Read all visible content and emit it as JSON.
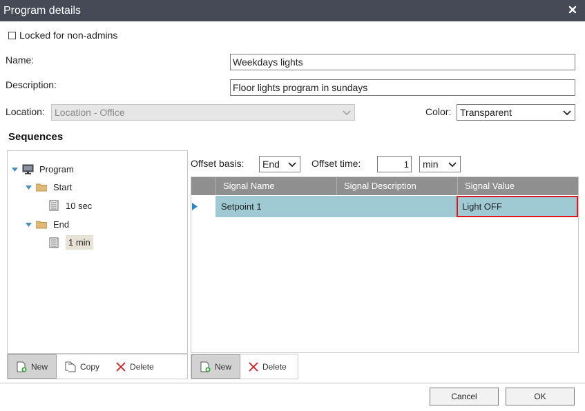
{
  "dialog": {
    "title": "Program details"
  },
  "locked": {
    "label": "Locked for non-admins",
    "checked": false
  },
  "fields": {
    "name_label": "Name:",
    "name_value": "Weekdays lights",
    "description_label": "Description:",
    "description_value": "Floor lights program in sundays",
    "location_label": "Location:",
    "location_value": "Location - Office",
    "color_label": "Color:",
    "color_value": "Transparent"
  },
  "sequences": {
    "title": "Sequences",
    "tree": {
      "root": "Program",
      "start": "Start",
      "start_child": "10 sec",
      "end": "End",
      "end_child": "1 min"
    },
    "toolbar": {
      "new": "New",
      "copy": "Copy",
      "delete": "Delete"
    }
  },
  "offset": {
    "basis_label": "Offset basis:",
    "basis_value": "End",
    "time_label": "Offset time:",
    "time_value": "1",
    "unit_value": "min"
  },
  "signals": {
    "columns": [
      "Signal Name",
      "Signal Description",
      "Signal Value"
    ],
    "rows": [
      {
        "name": "Setpoint 1",
        "description": "",
        "value": "Light OFF"
      }
    ],
    "toolbar": {
      "new": "New",
      "delete": "Delete"
    }
  },
  "buttons": {
    "cancel": "Cancel",
    "ok": "OK"
  },
  "colors": {
    "titlebar": "#464a57",
    "selected_row": "#9fcad4",
    "grid_header": "#8f8f8f",
    "highlight_border": "#e0141e",
    "folder": "#e0b978",
    "expand_triangle": "#4a90b8"
  }
}
